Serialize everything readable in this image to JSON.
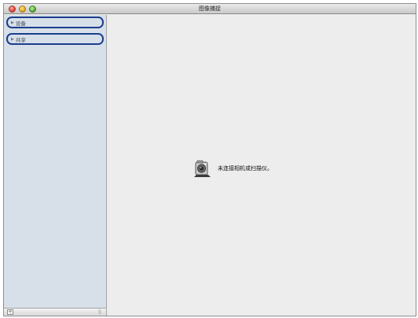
{
  "window": {
    "title": "图像捕捉"
  },
  "sidebar": {
    "sections": [
      {
        "label": "设备"
      },
      {
        "label": "共享"
      }
    ],
    "footer": {
      "add_label": "+",
      "grip": "||"
    }
  },
  "main": {
    "status_message": "未连接相机或扫描仪。"
  },
  "colors": {
    "sidebar_bg": "#d7dfe9",
    "highlight_ring": "#1a3f8c",
    "content_bg": "#ededed"
  }
}
